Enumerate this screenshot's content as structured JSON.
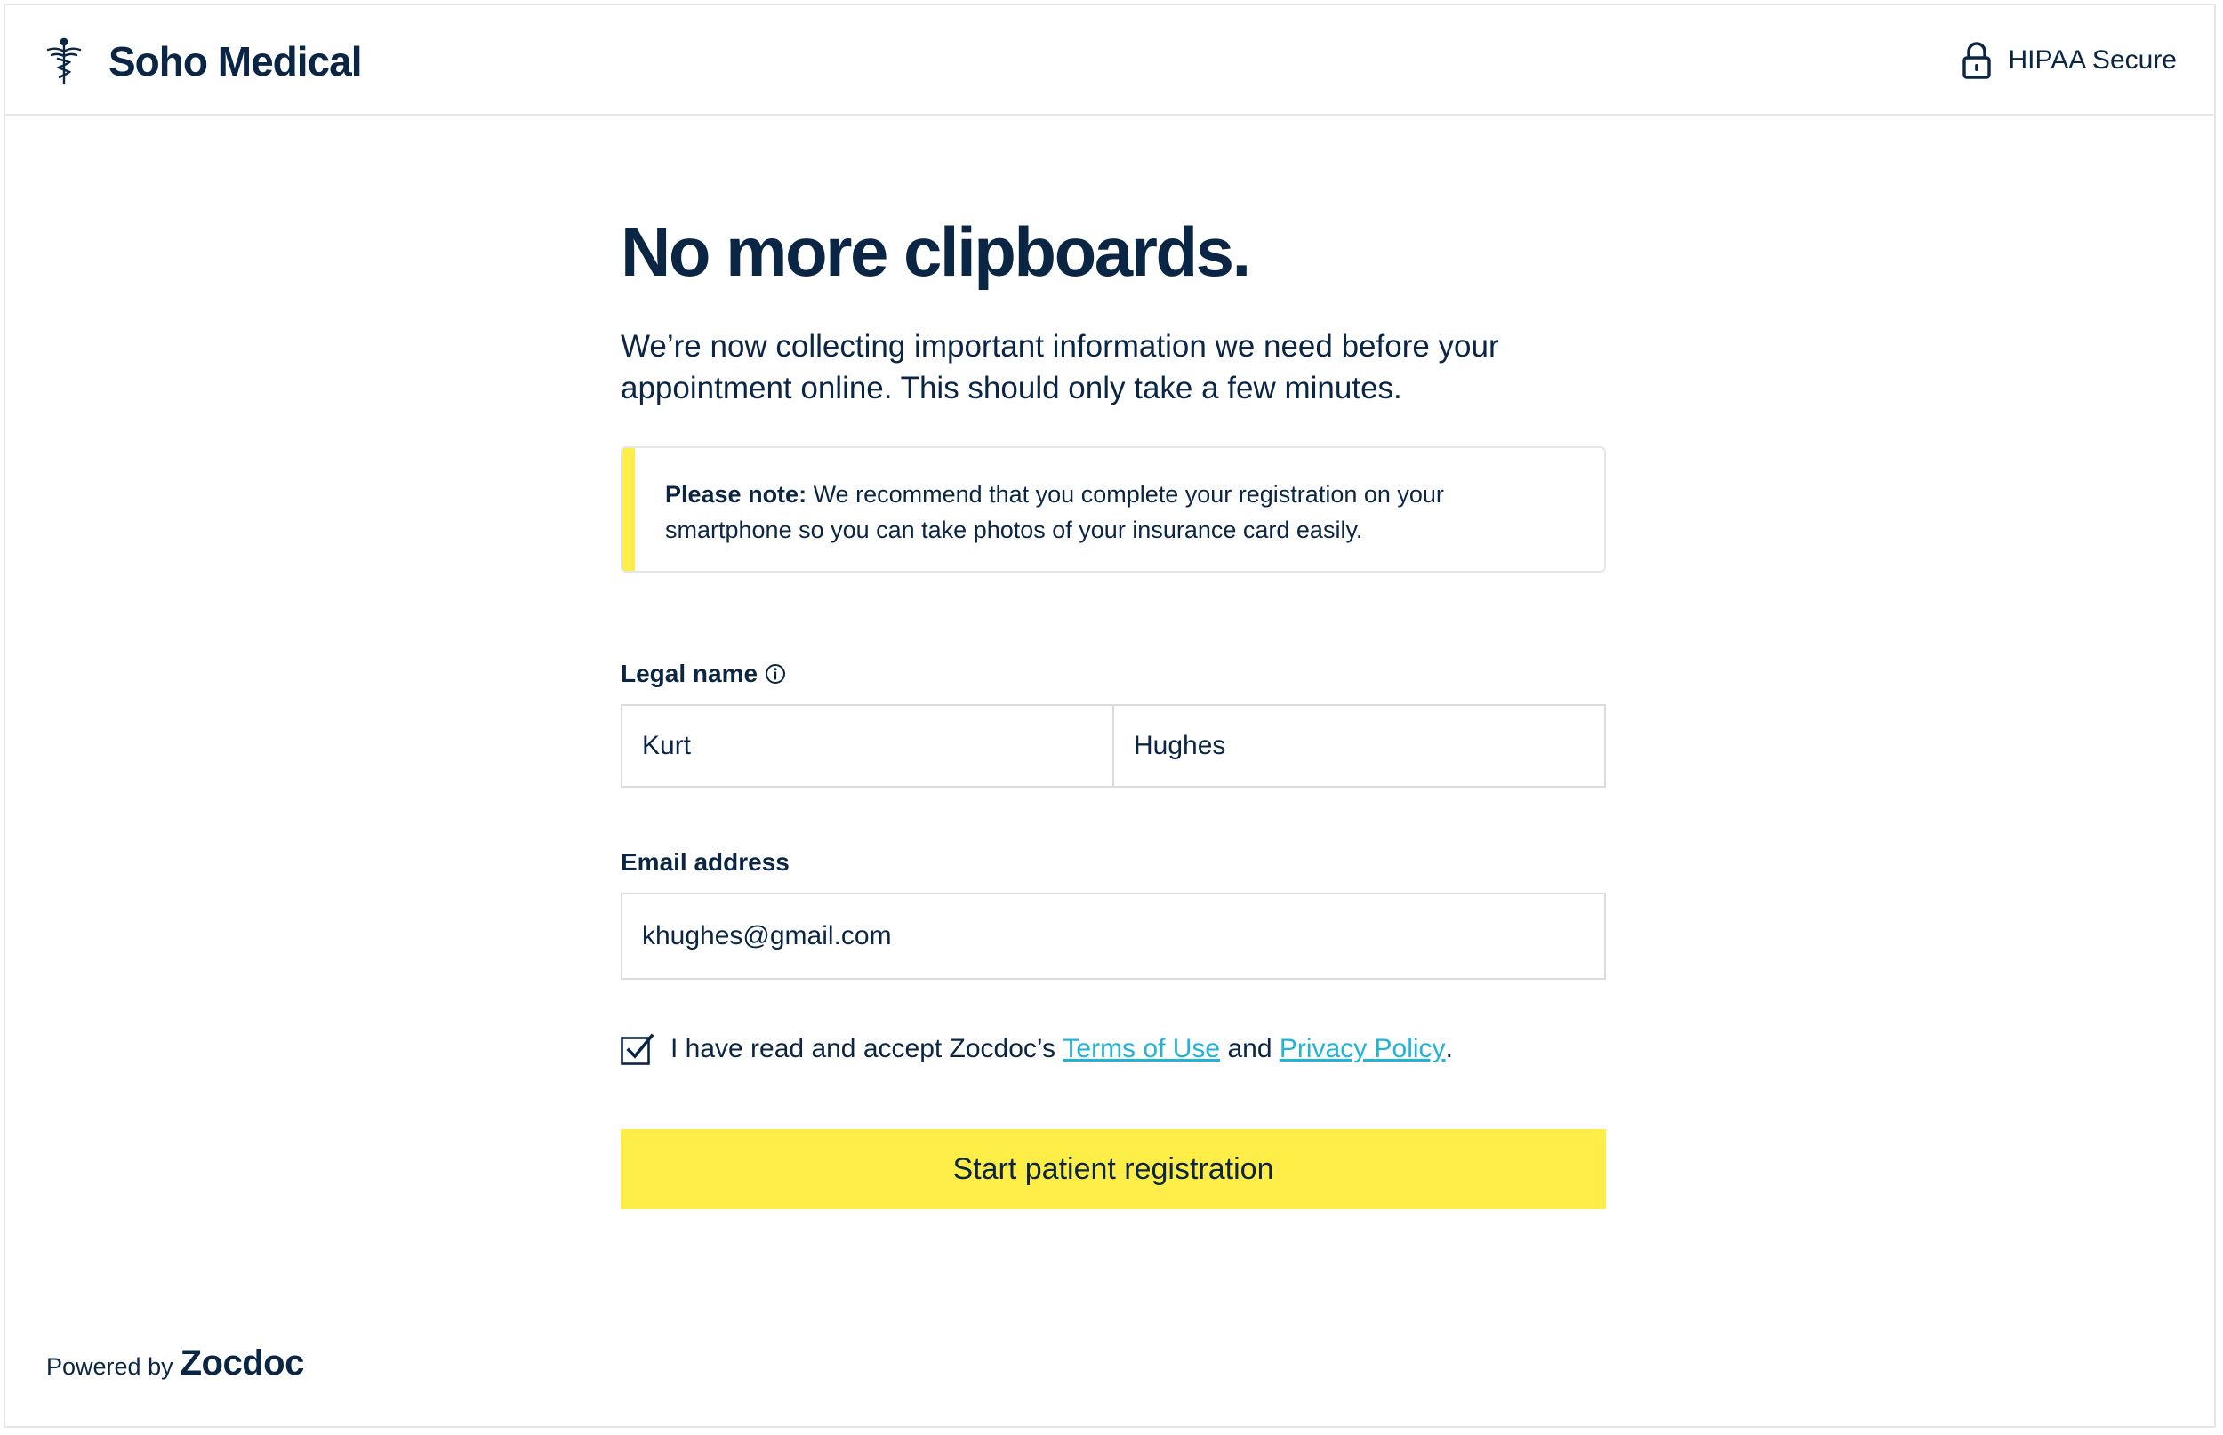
{
  "header": {
    "brand_name": "Soho Medical",
    "brand_icon": "caduceus-icon",
    "secure_label": "HIPAA Secure",
    "secure_icon": "lock-icon"
  },
  "intro": {
    "title": "No more clipboards.",
    "subtitle": "We’re now collecting important information we need before your appointment online. This should only take a few minutes."
  },
  "note": {
    "label": "Please note:",
    "text": " We recommend that you complete your registration on your smartphone so you can take photos of your insurance card easily."
  },
  "form": {
    "legal_name_label": "Legal name",
    "first_name_value": "Kurt",
    "last_name_value": "Hughes",
    "email_label": "Email address",
    "email_value": "khughes@gmail.com",
    "consent_checked": true,
    "consent_prefix": "I have read and accept Zocdoc’s ",
    "terms_link": "Terms of Use",
    "consent_and": " and ",
    "privacy_link": "Privacy Policy",
    "consent_suffix": ".",
    "submit_label": "Start patient registration"
  },
  "footer": {
    "powered_by": "Powered by",
    "brand": "Zocdoc"
  },
  "colors": {
    "navy": "#0b2545",
    "accent_yellow": "#ffee47",
    "link_blue": "#22b3d8",
    "border_gray": "#d8dbe0"
  }
}
